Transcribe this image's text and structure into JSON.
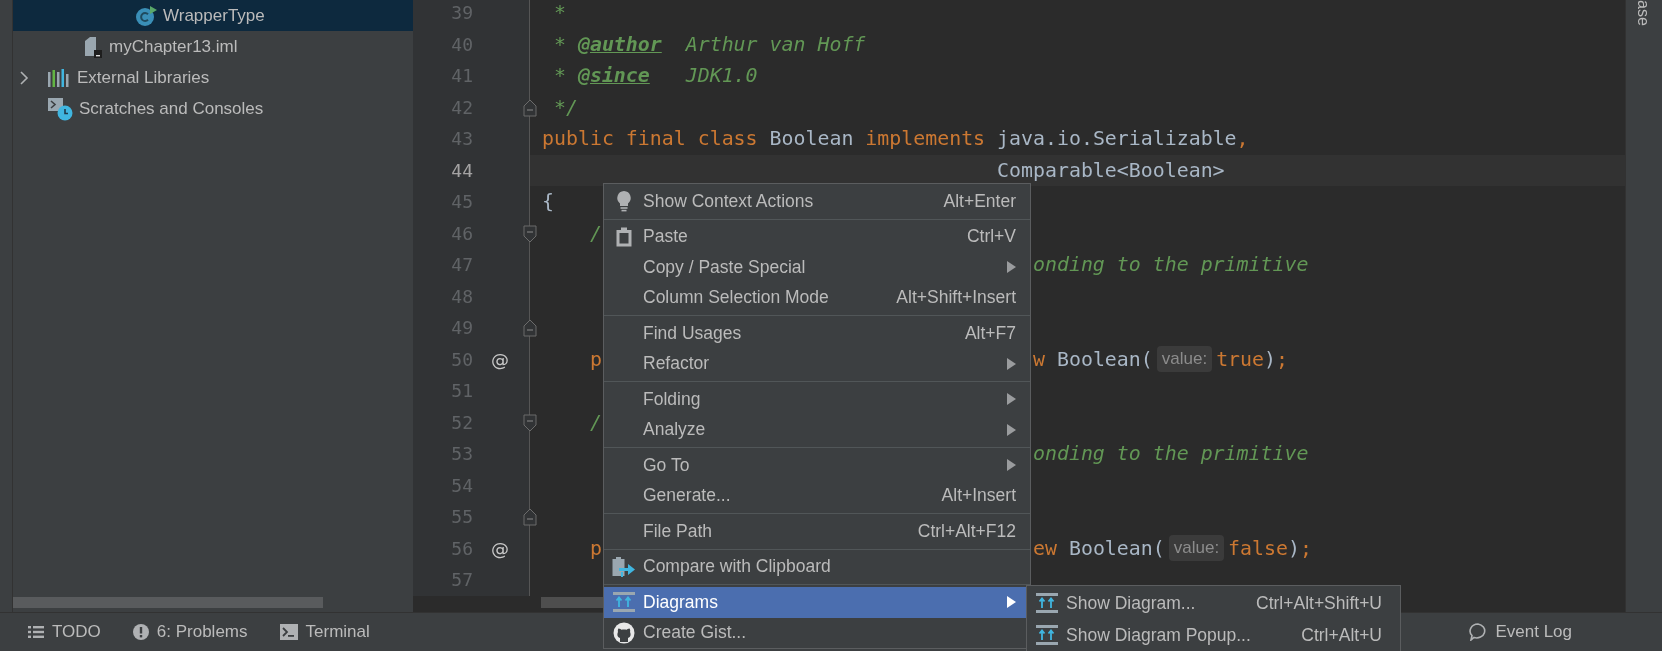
{
  "tree": [
    {
      "label": "WrapperType",
      "kind": "class",
      "selected": true
    },
    {
      "label": "myChapter13.iml",
      "kind": "file",
      "selected": false
    },
    {
      "label": "External Libraries",
      "kind": "libraries",
      "selected": false,
      "expanded": false
    },
    {
      "label": "Scratches and Consoles",
      "kind": "scratches",
      "selected": false
    }
  ],
  "lines": [
    {
      "number": "39",
      "current": false,
      "runs": [
        {
          "spans": [
            {
              "kind": "comment",
              "text": " *"
            }
          ]
        }
      ]
    },
    {
      "number": "40",
      "current": false,
      "runs": [
        {
          "spans": [
            {
              "kind": "comment",
              "text": " * "
            },
            {
              "kind": "doctag",
              "text": "@author"
            },
            {
              "kind": "comment",
              "text": "  Arthur van Hoff"
            }
          ]
        }
      ]
    },
    {
      "number": "41",
      "current": false,
      "runs": [
        {
          "spans": [
            {
              "kind": "comment",
              "text": " * "
            },
            {
              "kind": "doctag",
              "text": "@since"
            },
            {
              "kind": "comment",
              "text": "   JDK1.0"
            }
          ]
        }
      ]
    },
    {
      "number": "42",
      "current": false,
      "fold_open": false,
      "runs": [
        {
          "spans": [
            {
              "kind": "comment",
              "text": " */"
            }
          ]
        }
      ]
    },
    {
      "number": "43",
      "current": false,
      "runs": [
        {
          "spans": [
            {
              "kind": "keyword",
              "text": "public final class"
            },
            {
              "kind": "plain",
              "text": " Boolean "
            },
            {
              "kind": "keyword",
              "text": "implements"
            },
            {
              "kind": "plain",
              "text": " java.io.Serializable"
            },
            {
              "kind": "keyword",
              "text": ","
            }
          ]
        }
      ]
    },
    {
      "number": "44",
      "current": true,
      "runs": [
        {
          "spans": [
            {
              "kind": "plain",
              "text": "                                      Comparable<Boolean>"
            }
          ]
        }
      ]
    },
    {
      "number": "45",
      "current": false,
      "runs": [
        {
          "spans": [
            {
              "kind": "plain",
              "text": "{"
            }
          ]
        }
      ]
    },
    {
      "number": "46",
      "current": false,
      "fold_open": true,
      "runs": [
        {
          "spans": [
            {
              "kind": "comment",
              "text": "    /"
            }
          ]
        }
      ]
    },
    {
      "number": "47",
      "current": false,
      "runs": [
        {
          "spans": [
            {
              "kind": "comment",
              "text": "                                         onding to the primitive"
            }
          ]
        }
      ]
    },
    {
      "number": "48",
      "current": false
    },
    {
      "number": "49",
      "current": false,
      "fold_open": false
    },
    {
      "number": "50",
      "current": false,
      "mark": "@",
      "runs": [
        {
          "spans": [
            {
              "kind": "keyword",
              "text": "    p"
            }
          ]
        },
        {
          "spans": [
            {
              "kind": "keyword",
              "text": "                                    w"
            },
            {
              "kind": "plain",
              "text": " Boolean("
            }
          ]
        },
        {
          "hint": "value:"
        },
        {
          "spans": [
            {
              "kind": "keyword",
              "text": "true"
            },
            {
              "kind": "plain",
              "text": ")"
            },
            {
              "kind": "keyword",
              "text": ";"
            }
          ]
        }
      ]
    },
    {
      "number": "51",
      "current": false
    },
    {
      "number": "52",
      "current": false,
      "fold_open": true,
      "runs": [
        {
          "spans": [
            {
              "kind": "comment",
              "text": "    /"
            }
          ]
        }
      ]
    },
    {
      "number": "53",
      "current": false,
      "runs": [
        {
          "spans": [
            {
              "kind": "comment",
              "text": "                                         onding to the primitive"
            }
          ]
        }
      ]
    },
    {
      "number": "54",
      "current": false
    },
    {
      "number": "55",
      "current": false,
      "fold_open": false
    },
    {
      "number": "56",
      "current": false,
      "mark": "@",
      "runs": [
        {
          "spans": [
            {
              "kind": "keyword",
              "text": "    p"
            }
          ]
        },
        {
          "spans": [
            {
              "kind": "keyword",
              "text": "                                    ew"
            },
            {
              "kind": "plain",
              "text": " Boolean("
            }
          ]
        },
        {
          "hint": "value:"
        },
        {
          "spans": [
            {
              "kind": "keyword",
              "text": "false"
            },
            {
              "kind": "plain",
              "text": ")"
            },
            {
              "kind": "keyword",
              "text": ";"
            }
          ]
        }
      ]
    },
    {
      "number": "57",
      "current": false
    }
  ],
  "menu": {
    "groups": [
      [
        {
          "label": "Show Context Actions",
          "shortcut": "Alt+Enter",
          "submenu": false,
          "selected": false
        }
      ],
      [
        {
          "label": "Paste",
          "shortcut": "Ctrl+V",
          "submenu": false,
          "selected": false
        },
        {
          "label": "Copy / Paste Special",
          "submenu": true,
          "selected": false
        },
        {
          "label": "Column Selection Mode",
          "shortcut": "Alt+Shift+Insert",
          "submenu": false,
          "selected": false
        }
      ],
      [
        {
          "label": "Find Usages",
          "shortcut": "Alt+F7",
          "submenu": false,
          "selected": false
        },
        {
          "label": "Refactor",
          "submenu": true,
          "selected": false
        }
      ],
      [
        {
          "label": "Folding",
          "submenu": true,
          "selected": false
        },
        {
          "label": "Analyze",
          "submenu": true,
          "selected": false
        }
      ],
      [
        {
          "label": "Go To",
          "submenu": true,
          "selected": false
        },
        {
          "label": "Generate...",
          "shortcut": "Alt+Insert",
          "submenu": false,
          "selected": false
        }
      ],
      [
        {
          "label": "File Path",
          "shortcut": "Ctrl+Alt+F12",
          "submenu": false,
          "selected": false
        }
      ],
      [
        {
          "label": "Compare with Clipboard",
          "submenu": false,
          "selected": false
        }
      ],
      [
        {
          "label": "Diagrams",
          "submenu": true,
          "selected": true
        },
        {
          "label": "Create Gist...",
          "submenu": false,
          "selected": false
        }
      ]
    ]
  },
  "submenu": [
    {
      "label": "Show Diagram...",
      "shortcut": "Ctrl+Alt+Shift+U"
    },
    {
      "label": "Show Diagram Popup...",
      "shortcut": "Ctrl+Alt+U"
    }
  ],
  "right_stripe": "ase",
  "status_bar": {
    "tools": [
      {
        "label": "TODO"
      },
      {
        "label": "6: Problems"
      },
      {
        "label": "Terminal"
      }
    ],
    "event_log": "Event Log"
  }
}
